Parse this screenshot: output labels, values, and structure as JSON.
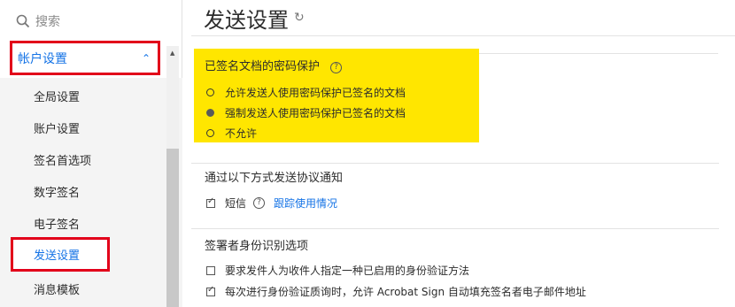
{
  "sidebar": {
    "search_placeholder": "搜索",
    "account_section": "帐户设置",
    "items": [
      {
        "label": "全局设置"
      },
      {
        "label": "账户设置"
      },
      {
        "label": "签名首选项"
      },
      {
        "label": "数字签名"
      },
      {
        "label": "电子签名"
      },
      {
        "label": "发送设置"
      },
      {
        "label": "消息模板"
      }
    ]
  },
  "main": {
    "title": "发送设置",
    "password_protection": {
      "title": "已签名文档的密码保护",
      "options": [
        {
          "label": "允许发送人使用密码保护已签名的文档",
          "selected": false
        },
        {
          "label": "强制发送人使用密码保护已签名的文档",
          "selected": true
        },
        {
          "label": "不允许",
          "selected": false
        }
      ]
    },
    "notification": {
      "title": "通过以下方式发送协议通知",
      "sms_label": "短信",
      "sms_checked": true,
      "track_link": "跟踪使用情况"
    },
    "signer_identity": {
      "title": "签署者身份识别选项",
      "options": [
        {
          "label": "要求发件人为收件人指定一种已启用的身份验证方法",
          "checked": false
        },
        {
          "label": "每次进行身份验证质询时，允许 Acrobat Sign 自动填充签名者电子邮件地址",
          "checked": true
        }
      ]
    }
  },
  "colors": {
    "accent": "#1473e6",
    "highlight": "#ffe600",
    "annotation_red": "#e2001a"
  },
  "icons": {
    "search": "search-icon",
    "collapse": "chevron-up-icon",
    "refresh": "refresh-icon",
    "help": "help-icon"
  }
}
